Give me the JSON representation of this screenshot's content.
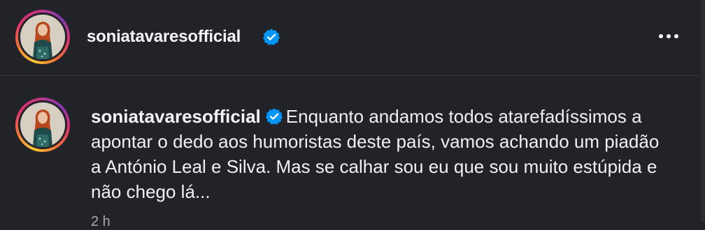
{
  "post": {
    "author": "soniatavaresofficial",
    "verified": true
  },
  "comment": {
    "author": "soniatavaresofficial",
    "text": "Enquanto andamos todos atarefadíssimos a apontar o dedo aos humoristas deste país, vamos achando um piadão a António Leal e Silva. Mas se calhar sou eu que sou muito estúpida e não chego lá...",
    "timestamp": "2 h"
  },
  "icons": {
    "more": "more-options-icon",
    "verified": "verified-badge-icon"
  },
  "colors": {
    "background": "#212328",
    "verified_blue": "#0095f6",
    "text": "#f5f5f5",
    "muted": "#a8a8a8"
  }
}
